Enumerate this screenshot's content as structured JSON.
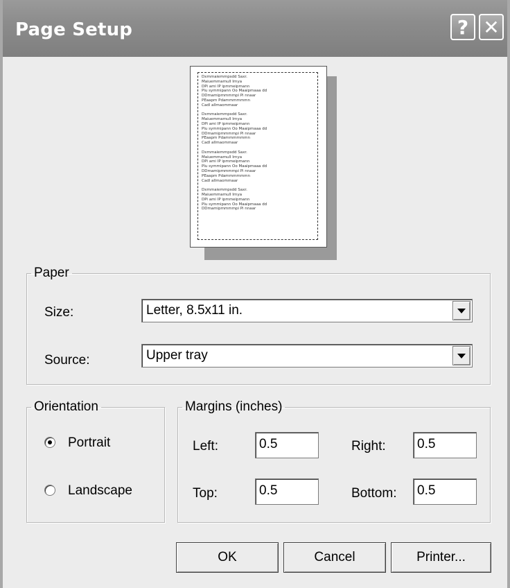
{
  "window": {
    "title": "Page Setup",
    "help_label": "?",
    "close_label": "✕"
  },
  "preview": {
    "lines": [
      "Dxmmaiemmpsdd Saxr.",
      "Maiuemmamull Irnya",
      "DPi ami IP ipmmeipmann",
      "Plu symmipann Oo Maaipmaaa dd",
      "DDmamipmmmmpi Pi nnaar",
      "PEaapm Pdammmmmmn",
      "Cadl allmaommaar",
      "",
      "Dxmmaiemmpsdd Saxr.",
      "Maiuemmamull Irnya",
      "DPi ami IP ipmmeipmann",
      "Plu symmipann Oo Maaipmaaa dd",
      "DDmamipmmmmpi Pi nnaar",
      "PEaapm Pdammmmmmn",
      "Cadl allmaommaar",
      "",
      "Dxmmaiemmpsdd Saxr.",
      "Maiuemmamull Irnya",
      "DPi ami IP ipmmeipmann",
      "Plu symmipann Oo Maaipmaaa dd",
      "DDmamipmmmmpi Pi nnaar",
      "PEaapm Pdammmmmmn",
      "Cadl allmaommaar",
      "",
      "Dxmmaiemmpsdd Saxr.",
      "Maiuemmamull Irnya",
      "DPi ami IP ipmmeipmann",
      "Plu symmipann Oo Maaipmaaa dd",
      "DDmamipmmmmpi Pi nnaar"
    ]
  },
  "paper": {
    "legend": "Paper",
    "size_label": "Size:",
    "size_value": "Letter, 8.5x11 in.",
    "source_label": "Source:",
    "source_value": "Upper tray"
  },
  "orientation": {
    "legend": "Orientation",
    "portrait_label": "Portrait",
    "landscape_label": "Landscape",
    "selected": "portrait"
  },
  "margins": {
    "legend": "Margins (inches)",
    "left_label": "Left:",
    "left_value": "0.5",
    "right_label": "Right:",
    "right_value": "0.5",
    "top_label": "Top:",
    "top_value": "0.5",
    "bottom_label": "Bottom:",
    "bottom_value": "0.5"
  },
  "buttons": {
    "ok": "OK",
    "cancel": "Cancel",
    "printer": "Printer..."
  }
}
